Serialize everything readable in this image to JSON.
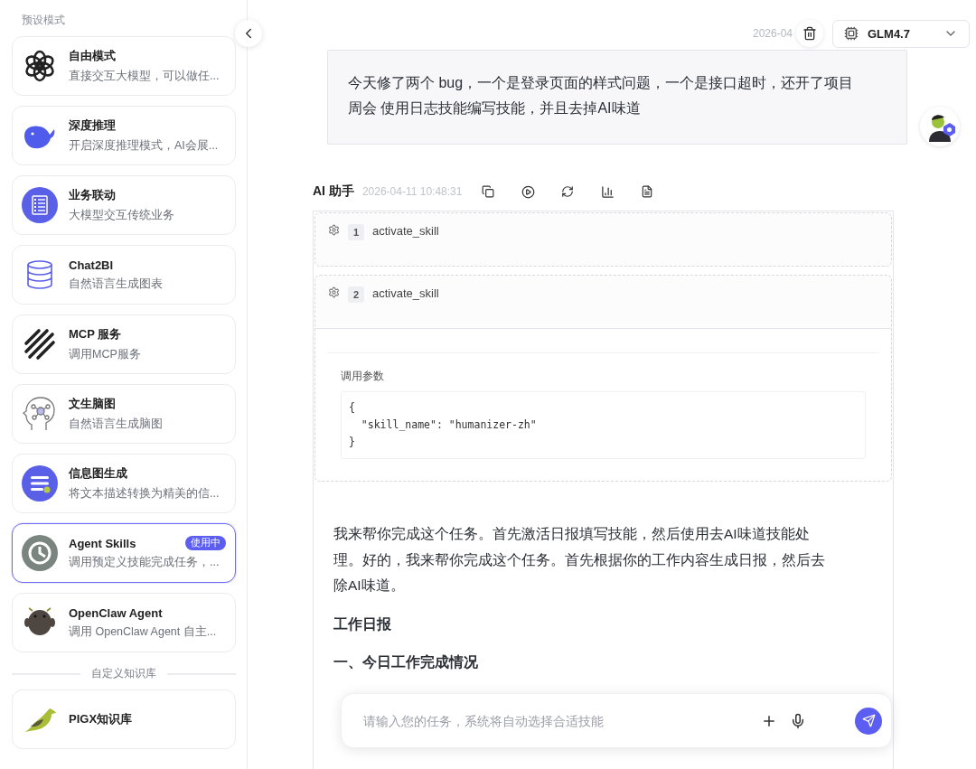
{
  "sidebar": {
    "section_title": "预设模式",
    "items": [
      {
        "kind": "knot",
        "title": "自由模式",
        "description": "直接交互大模型，可以做任...",
        "selected": false
      },
      {
        "kind": "whale",
        "title": "深度推理",
        "description": "开启深度推理模式，AI会展...",
        "selected": false
      },
      {
        "kind": "list",
        "title": "业务联动",
        "description": "大模型交互传统业务",
        "selected": false
      },
      {
        "kind": "database",
        "title": "Chat2BI",
        "description": "自然语言生成图表",
        "selected": false
      },
      {
        "kind": "stripes",
        "title": "MCP 服务",
        "description": "调用MCP服务",
        "selected": false
      },
      {
        "kind": "head",
        "title": "文生脑图",
        "description": "自然语言生成脑图",
        "selected": false
      },
      {
        "kind": "lines",
        "title": "信息图生成",
        "description": "将文本描述转换为精美的信...",
        "selected": false
      },
      {
        "kind": "clock",
        "title": "Agent Skills",
        "description": "调用预定义技能完成任务，...",
        "selected": true,
        "badge": "使用中"
      },
      {
        "kind": "creature",
        "title": "OpenClaw Agent",
        "description": "调用 OpenClaw Agent 自主...",
        "selected": false
      }
    ],
    "divider_label": "自定义知识库",
    "knowledge_items": [
      {
        "kind": "bird",
        "title": "PIGX知识库",
        "selected": false
      }
    ]
  },
  "header": {
    "time": "2026-04",
    "model": "GLM4.7"
  },
  "user_message": {
    "text": "今天修了两个 bug，一个是登录页面的样式问题，一个是接口超时，还开了项目周会 使用日志技能编写技能，并且去掉AI味道"
  },
  "assistant": {
    "name": "AI 助手",
    "time": "2026-04-11 10:48:31",
    "steps": [
      {
        "number": "1",
        "name": "activate_skill",
        "expanded": false
      },
      {
        "number": "2",
        "name": "activate_skill",
        "expanded": true,
        "params_label": "调用参数",
        "params": [
          "{",
          "  \"skill_name\": \"humanizer-zh\"",
          "}"
        ]
      }
    ],
    "reply": "我来帮你完成这个任务。首先激活日报填写技能，然后使用去AI味道技能处理。好的，我来帮你完成这个任务。首先根据你的工作内容生成日报，然后去除AI味道。",
    "headings": [
      "工作日报",
      "一、今日工作完成情况"
    ]
  },
  "input": {
    "placeholder": "请输入您的任务，系统将自动选择合适技能"
  }
}
